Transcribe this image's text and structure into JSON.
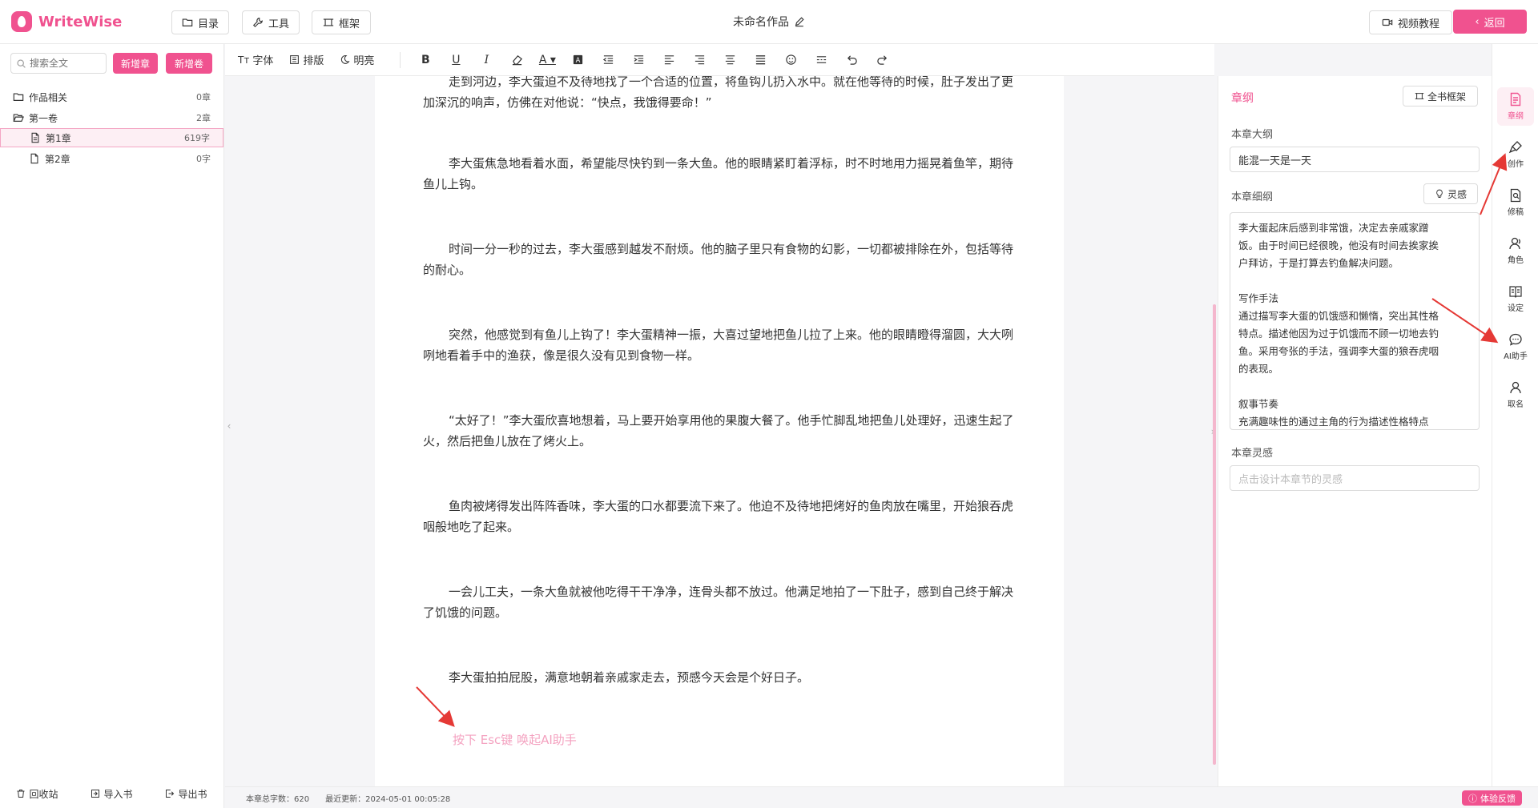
{
  "app": {
    "name": "WriteWise",
    "doc_title": "未命名作品"
  },
  "header": {
    "buttons": [
      {
        "label": "目录",
        "icon": "folder-icon"
      },
      {
        "label": "工具",
        "icon": "wrench-icon"
      },
      {
        "label": "框架",
        "icon": "frame-icon"
      }
    ],
    "video_tutorial": "视频教程",
    "return": "返回"
  },
  "sidebar": {
    "search_placeholder": "搜索全文",
    "new_chapter": "新增章",
    "new_volume": "新增卷",
    "tree": [
      {
        "label": "作品相关",
        "count": "0章",
        "level": 0,
        "icon": "folder-icon"
      },
      {
        "label": "第一卷",
        "count": "2章",
        "level": 0,
        "icon": "folder-open-icon"
      },
      {
        "label": "第1章",
        "count": "619字",
        "level": 1,
        "icon": "file-icon",
        "active": true
      },
      {
        "label": "第2章",
        "count": "0字",
        "level": 1,
        "icon": "file-icon"
      }
    ],
    "footer": {
      "recycle": "回收站",
      "import": "导入书",
      "export": "导出书"
    }
  },
  "toolbar": {
    "font": "字体",
    "layout": "排版",
    "brightness": "明亮"
  },
  "editor": {
    "paragraphs": [
      "走到河边，李大蛋迫不及待地找了一个合适的位置，将鱼钩儿扔入水中。就在他等待的时候，肚子发出了更加深沉的响声，仿佛在对他说：“快点，我饿得要命！”",
      "李大蛋焦急地看着水面，希望能尽快钓到一条大鱼。他的眼睛紧盯着浮标，时不时地用力摇晃着鱼竿，期待鱼儿上钩。",
      "时间一分一秒的过去，李大蛋感到越发不耐烦。他的脑子里只有食物的幻影，一切都被排除在外，包括等待的耐心。",
      "突然，他感觉到有鱼儿上钩了！李大蛋精神一振，大喜过望地把鱼儿拉了上来。他的眼睛瞪得溜圆，大大咧咧地看着手中的渔获，像是很久没有见到食物一样。",
      "“太好了！”李大蛋欣喜地想着，马上要开始享用他的果腹大餐了。他手忙脚乱地把鱼儿处理好，迅速生起了火，然后把鱼儿放在了烤火上。",
      "鱼肉被烤得发出阵阵香味，李大蛋的口水都要流下来了。他迫不及待地把烤好的鱼肉放在嘴里，开始狼吞虎咽般地吃了起来。",
      "一会儿工夫，一条大鱼就被他吃得干干净净，连骨头都不放过。他满足地拍了一下肚子，感到自己终于解决了饥饿的问题。",
      "李大蛋拍拍屁股，满意地朝着亲戚家走去，预感今天会是个好日子。"
    ],
    "hint": "按下 Esc键 唤起AI助手"
  },
  "status": {
    "total_words": "本章总字数：620",
    "last_update": "最近更新：2024-05-01 00:05:28",
    "feedback": "体验反馈"
  },
  "outline_panel": {
    "title": "章纲",
    "whole_book_frame": "全书框架",
    "chapter_outline_label": "本章大纲",
    "chapter_outline_value": "能混一天是一天",
    "chapter_detail_label": "本章细纲",
    "inspiration_btn": "灵感",
    "chapter_detail_lines": [
      "李大蛋起床后感到非常饿，决定去亲戚家蹭",
      "饭。由于时间已经很晚，他没有时间去挨家挨",
      "户拜访，于是打算去钓鱼解决问题。",
      "",
      "写作手法",
      "通过描写李大蛋的饥饿感和懒惰，突出其性格",
      "特点。描述他因为过于饥饿而不顾一切地去钓",
      "鱼。采用夸张的手法，强调李大蛋的狼吞虎咽",
      "的表现。",
      "",
      "叙事节奏",
      "充满趣味性的通过主角的行为描述性格特点"
    ],
    "inspiration_label": "本章灵感",
    "inspiration_placeholder": "点击设计本章节的灵感"
  },
  "icon_nav": [
    {
      "label": "章纲",
      "icon": "outline-icon",
      "active": true
    },
    {
      "label": "创作",
      "icon": "brush-icon"
    },
    {
      "label": "修稿",
      "icon": "revise-icon"
    },
    {
      "label": "角色",
      "icon": "character-icon"
    },
    {
      "label": "设定",
      "icon": "book-icon"
    },
    {
      "label": "AI助手",
      "icon": "chat-icon"
    },
    {
      "label": "取名",
      "icon": "user-icon"
    }
  ],
  "colors": {
    "accent": "#f0528f",
    "accent_light": "#fdeff4",
    "arrow": "#e53935"
  }
}
